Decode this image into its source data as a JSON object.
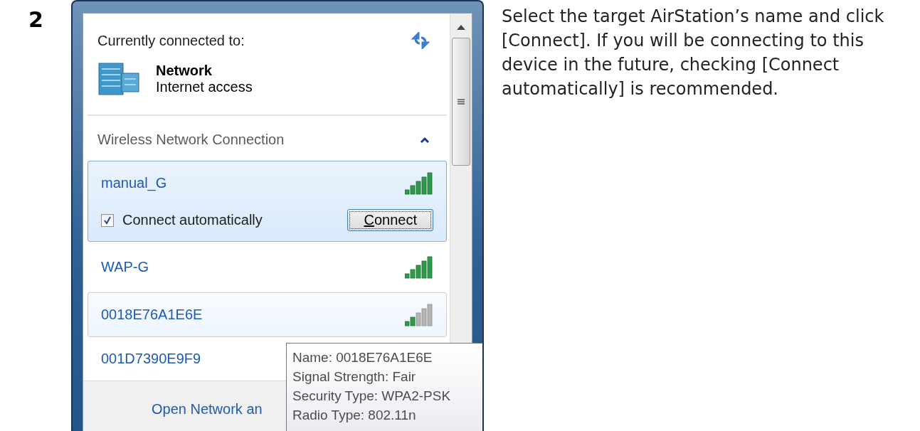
{
  "step": "2",
  "instructions": "Select the target AirStation’s name and click [Connect]. If you will be connecting to this device in the future, checking [Connect automatically] is recommended.",
  "window": {
    "connected_heading": "Currently connected to:",
    "connection": {
      "name": "Network",
      "status": "Internet access"
    },
    "section": {
      "title": "Wireless Network Connection",
      "expanded": true
    },
    "networks": [
      {
        "name": "manual_G",
        "weak_signal": false,
        "selected": true,
        "hovered": false,
        "expanded": true,
        "connect_automatically": {
          "label": "Connect automatically",
          "checked": true
        },
        "connect_button": "Connect"
      },
      {
        "name": "WAP-G",
        "weak_signal": false,
        "selected": false,
        "hovered": false,
        "expanded": false
      },
      {
        "name": "0018E76A1E6E",
        "weak_signal": true,
        "selected": false,
        "hovered": true,
        "expanded": false
      },
      {
        "name": "001D7390E9F9",
        "selected": false,
        "hovered": false,
        "expanded": false
      }
    ],
    "footer_link": "Open Network an",
    "tooltip": {
      "lines": [
        "Name: 0018E76A1E6E",
        "Signal Strength: Fair",
        "Security Type: WPA2-PSK",
        "Radio Type: 802.11n"
      ]
    }
  }
}
